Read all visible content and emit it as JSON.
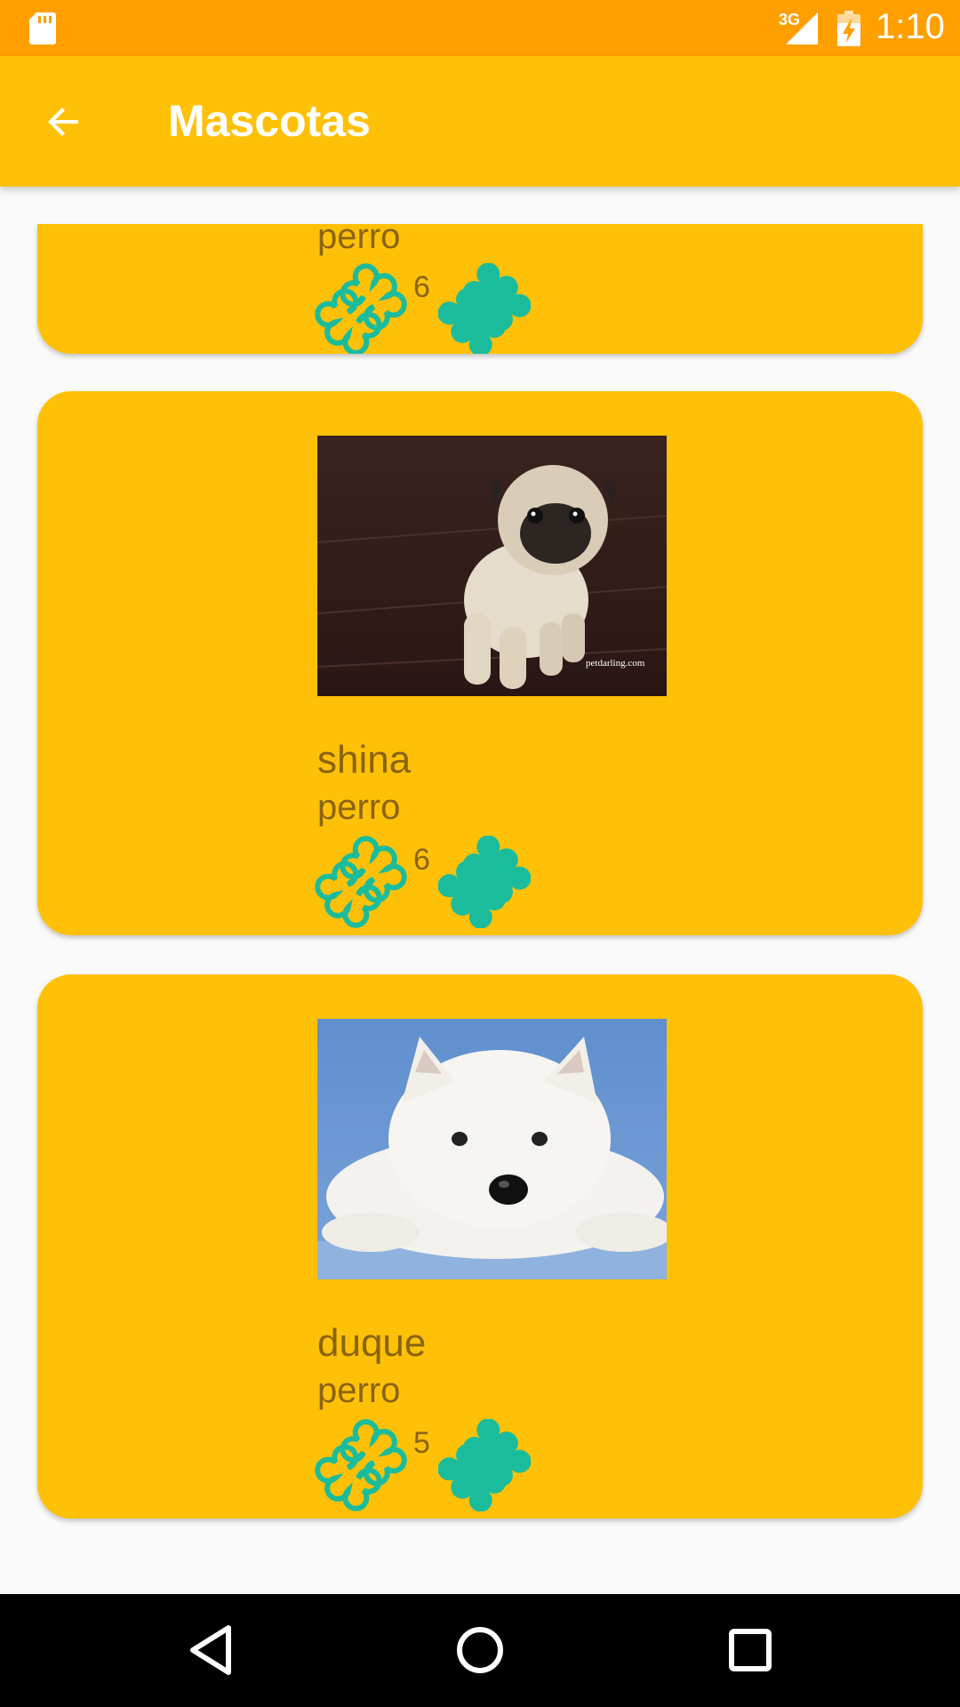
{
  "status_bar": {
    "time": "1:10",
    "network_label": "3G",
    "icons": [
      "sd-card-icon",
      "signal-icon",
      "battery-charging-icon"
    ]
  },
  "app_bar": {
    "title": "Mascotas",
    "back_icon": "arrow-back-icon"
  },
  "pets": [
    {
      "name": "",
      "type": "perro",
      "likes": "6",
      "photo": ""
    },
    {
      "name": "shina",
      "type": "perro",
      "likes": "6",
      "photo": "pug puppy",
      "watermark": "petdarling.com"
    },
    {
      "name": "duque",
      "type": "perro",
      "likes": "5",
      "photo": "white west highland terrier"
    }
  ],
  "nav_bar": {
    "buttons": [
      "back-triangle-icon",
      "home-circle-icon",
      "recents-square-icon"
    ]
  },
  "colors": {
    "status_bar": "#FFA000",
    "app_bar": "#FFC107",
    "card": "#FFC107",
    "text": "#8A6410",
    "bone": "#1ABC9C",
    "background": "#FAFAFA"
  }
}
